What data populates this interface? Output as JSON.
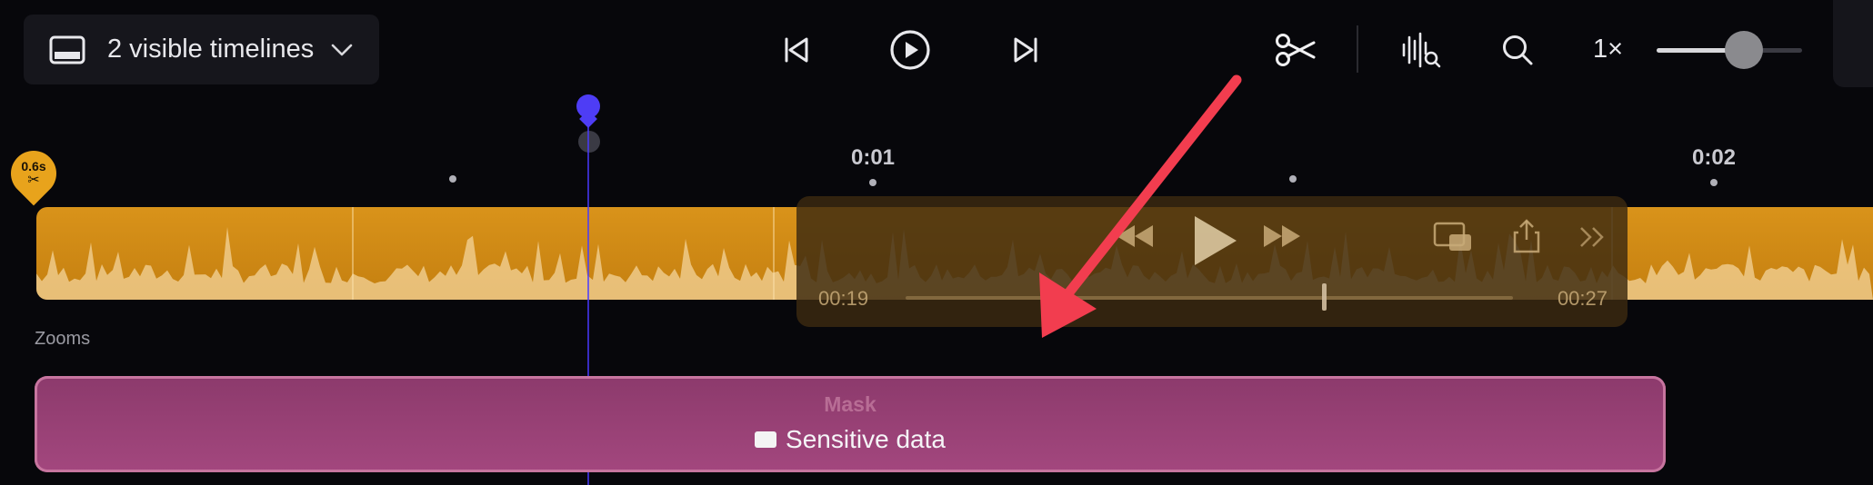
{
  "toolbar": {
    "timeline_selector_label": "2 visible timelines",
    "speed_label": "1×",
    "zoom_level": 0.6,
    "icons": {
      "timeline": "timeline-panel-icon",
      "chevron": "chevron-down-icon",
      "prev": "skip-back-icon",
      "play": "play-circle-icon",
      "next": "skip-forward-icon",
      "cut": "scissors-icon",
      "audio_search": "audio-search-icon",
      "search": "search-icon"
    }
  },
  "ruler": {
    "labels": [
      "0:01",
      "0:02"
    ]
  },
  "cut_marker": {
    "label": "0.6s",
    "glyph": "✂"
  },
  "media_overlay": {
    "time_start": "00:19",
    "time_end": "00:27",
    "icons": [
      "rewind-icon",
      "play-icon",
      "fast-forward-icon",
      "picture-in-picture-icon",
      "share-icon",
      "more-chevrons-icon"
    ]
  },
  "zooms": {
    "section_label": "Zooms",
    "mask": {
      "title": "Mask",
      "label": "Sensitive data"
    }
  },
  "colors": {
    "background": "#07070b",
    "audio_track": "#d9931a",
    "playhead": "#4e3df5",
    "mask_block": "#a3477e",
    "annotation_arrow": "#f23d4f"
  }
}
